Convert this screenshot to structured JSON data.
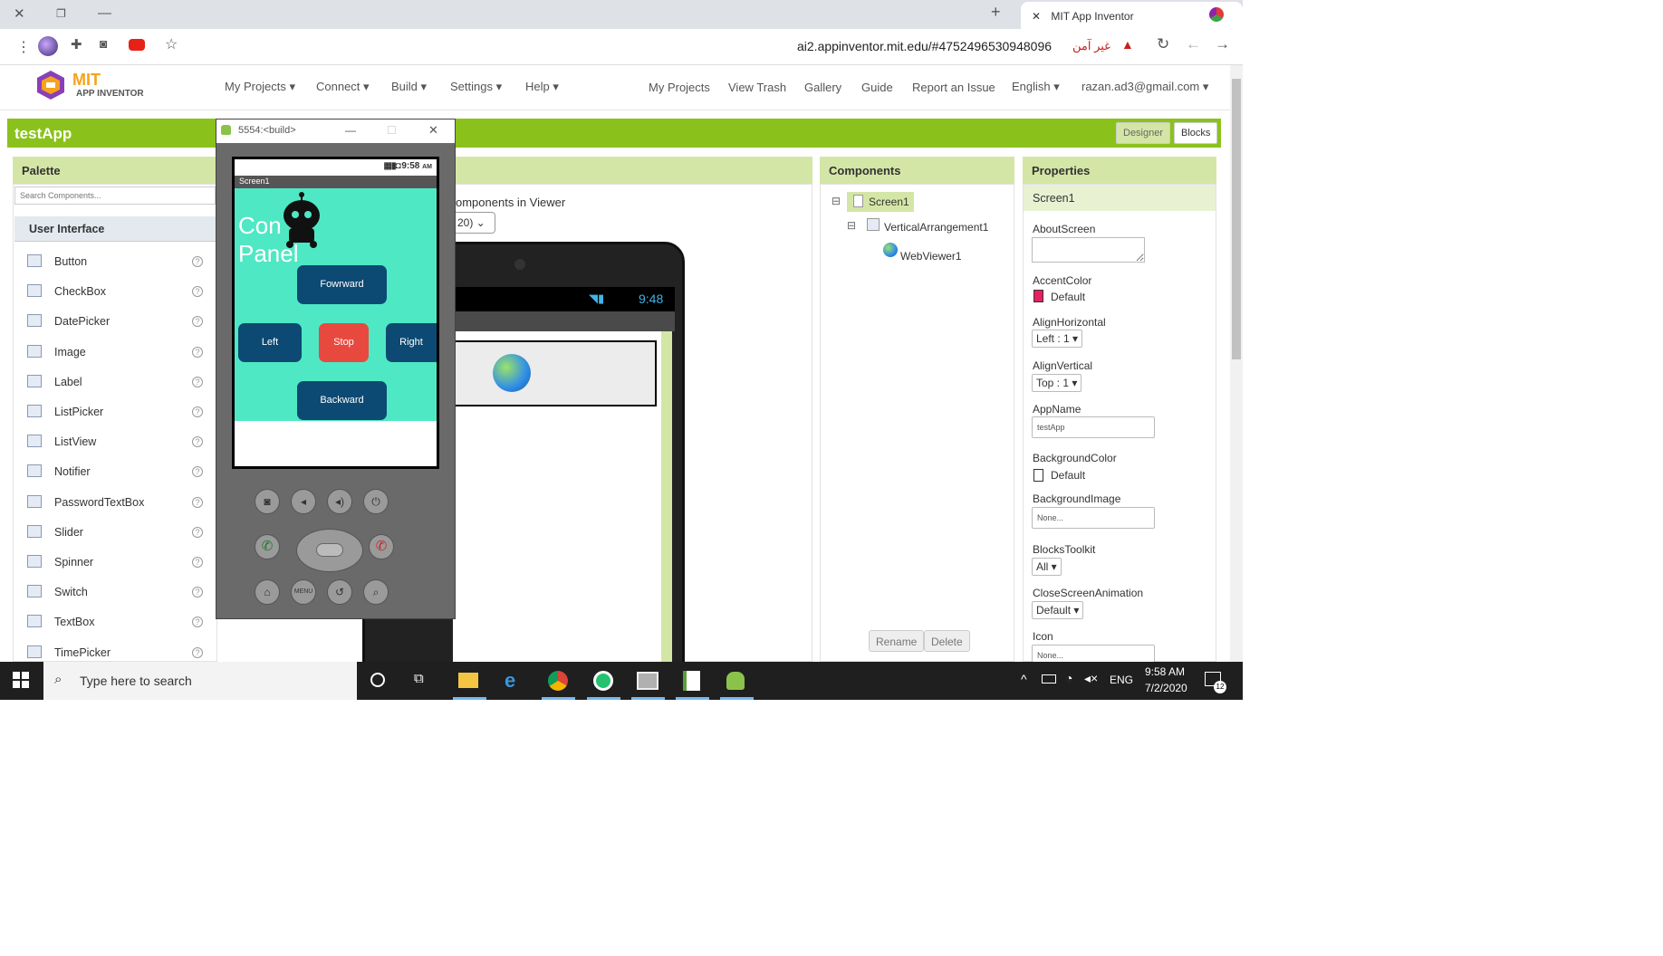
{
  "browser": {
    "tab_title": "MIT App Inventor",
    "url": "ai2.appinventor.mit.edu/#4752496530948096",
    "security_label": "غير آمن",
    "new_tab": "+",
    "tab_close": "✕"
  },
  "app_nav": {
    "brand_top": "MIT",
    "brand_bottom": "APP INVENTOR",
    "left_menu": [
      "My Projects ▾",
      "Connect ▾",
      "Build ▾",
      "Settings ▾",
      "Help ▾"
    ],
    "right_menu": [
      "My Projects",
      "View Trash",
      "Gallery",
      "Guide",
      "Report an Issue",
      "English ▾",
      "razan.ad3@gmail.com ▾"
    ]
  },
  "project": {
    "title": "testApp",
    "designer_label": "Designer",
    "blocks_label": "Blocks"
  },
  "palette": {
    "header": "Palette",
    "search_placeholder": "Search Components...",
    "section": "User Interface",
    "items": [
      "Button",
      "CheckBox",
      "DatePicker",
      "Image",
      "Label",
      "ListPicker",
      "ListView",
      "Notifier",
      "PasswordTextBox",
      "Slider",
      "Spinner",
      "Switch",
      "TextBox",
      "TimePicker"
    ],
    "help_glyph": "?"
  },
  "viewer": {
    "partial_text": "omponents in Viewer",
    "size_select": "20)",
    "phone_time": "9:48"
  },
  "components": {
    "header": "Components",
    "tree": [
      "Screen1",
      "VerticalArrangement1",
      "WebViewer1"
    ],
    "rename_label": "Rename",
    "delete_label": "Delete",
    "collapse_glyph": "⊟"
  },
  "properties": {
    "header": "Properties",
    "component": "Screen1",
    "about_label": "AboutScreen",
    "accent_label": "AccentColor",
    "accent_value": "Default",
    "accent_color": "#e91e63",
    "align_h_label": "AlignHorizontal",
    "align_h_value": "Left : 1 ▾",
    "align_v_label": "AlignVertical",
    "align_v_value": "Top : 1 ▾",
    "appname_label": "AppName",
    "appname_value": "testApp",
    "bgcolor_label": "BackgroundColor",
    "bgcolor_value": "Default",
    "bgimage_label": "BackgroundImage",
    "bgimage_value": "None...",
    "blocks_toolkit_label": "BlocksToolkit",
    "blocks_toolkit_value": "All ▾",
    "close_anim_label": "CloseScreenAnimation",
    "close_anim_value": "Default ▾",
    "icon_label": "Icon",
    "icon_value": "None..."
  },
  "emulator": {
    "title": "5554:<build>",
    "minimize": "—",
    "maximize": "☐",
    "close": "✕",
    "status_time": "9:58",
    "status_ampm": "AM",
    "screen_title": "Screen1",
    "heading_line1": "Con",
    "heading_line2": "Panel",
    "btn_forward": "Fowrward",
    "btn_left": "Left",
    "btn_stop": "Stop",
    "btn_right": "Right",
    "btn_backward": "Backward",
    "app_bg": "#4fe8c4",
    "btn_blue": "#0d4a73",
    "btn_red": "#e8493f",
    "menu_label": "MENU"
  },
  "taskbar": {
    "search_placeholder": "Type here to search",
    "language": "ENG",
    "time": "9:58 AM",
    "date": "7/2/2020",
    "notifications": "12"
  }
}
